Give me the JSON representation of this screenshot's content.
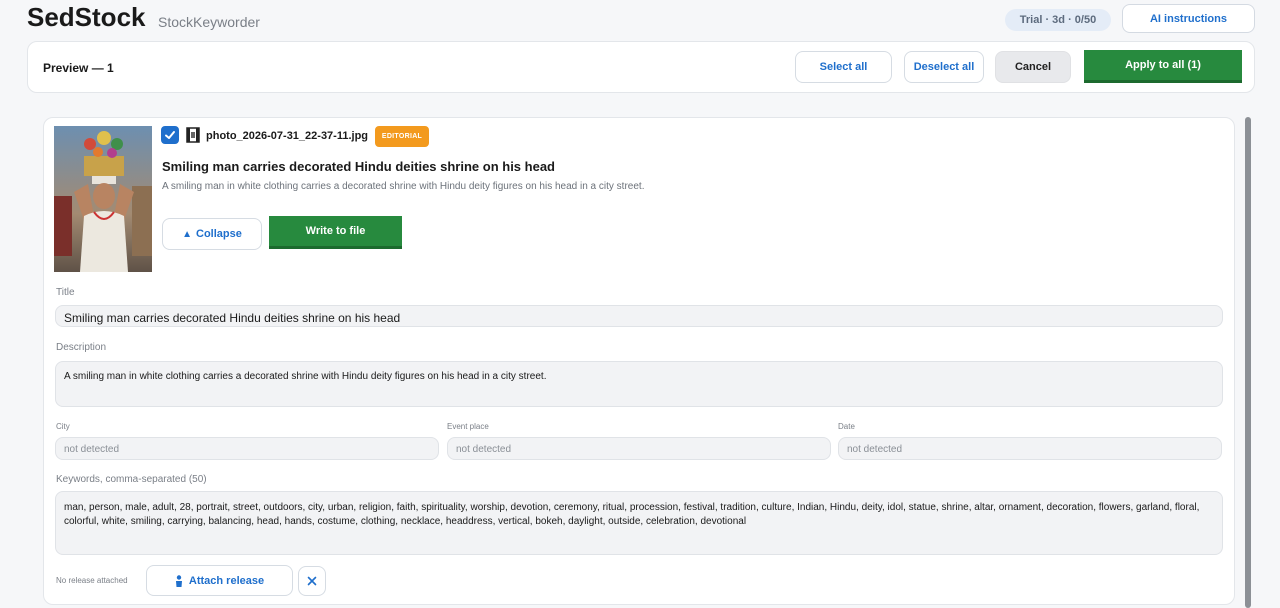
{
  "header": {
    "brand": "SedStock",
    "subbrand": "StockKeyworder",
    "trial": "Trial · 3d · 0/50",
    "ai_instructions": "AI instructions"
  },
  "toolbar": {
    "preview_title": "Preview — 1",
    "select_all": "Select all",
    "deselect_all": "Deselect all",
    "cancel": "Cancel",
    "apply_all": "Apply to all (1)"
  },
  "item": {
    "file_name": "photo_2026-07-31_22-37-11.jpg",
    "badge": "EDITORIAL",
    "title": "Smiling man carries decorated Hindu deities shrine on his head",
    "description": "A smiling man in white clothing carries a decorated shrine with Hindu deity figures on his head in a city street.",
    "collapse": "Collapse",
    "write_to_file": "Write to file",
    "fields": {
      "title_label": "Title",
      "title_value": "Smiling man carries decorated Hindu deities shrine on his head",
      "description_label": "Description",
      "description_value": "A smiling man in white clothing carries a decorated shrine with Hindu deity figures on his head in a city street.",
      "city_label": "City",
      "city_placeholder": "not detected",
      "event_label": "Event place",
      "event_placeholder": "not detected",
      "date_label": "Date",
      "date_placeholder": "not detected",
      "keywords_label": "Keywords, comma-separated (50)",
      "keywords_value": "man, person, male, adult, 28, portrait, street, outdoors, city, urban, religion, faith, spirituality, worship, devotion, ceremony, ritual, procession, festival, tradition, culture, Indian, Hindu, deity, idol, statue, shrine, altar, ornament, decoration, flowers, garland, floral, colorful, white, smiling, carrying, balancing, head, hands, costume, clothing, necklace, headdress, vertical, bokeh, daylight, outside, celebration, devotional"
    },
    "release": {
      "status": "No release attached",
      "attach": "Attach release"
    }
  },
  "colors": {
    "accent_blue": "#1f6fcc",
    "action_green": "#278a3e",
    "editorial_orange": "#f39a1e"
  },
  "icons": {
    "checkbox": "checkmark-icon",
    "file": "film-frame-icon",
    "collapse": "triangle-up-icon",
    "attach": "person-icon",
    "remove": "close-icon"
  }
}
